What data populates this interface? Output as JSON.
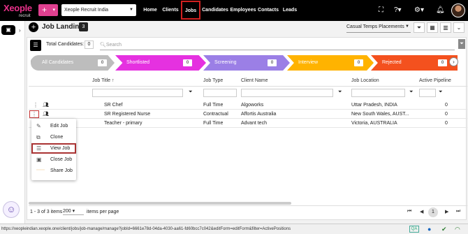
{
  "topbar": {
    "logo_brand": "Xeople",
    "logo_sub": "recruit",
    "add_label": "+",
    "tenant": "Xeople Recruit India",
    "nav": [
      "Home",
      "Clients",
      "Jobs",
      "Candidates",
      "Employees",
      "Contacts",
      "Leads"
    ],
    "active_nav": "Jobs"
  },
  "page": {
    "title": "Job Landing",
    "count": "3",
    "view_select": "Casual Temps Placements"
  },
  "grid": {
    "total_label": "Total Candidates:",
    "total_value": "0",
    "search_placeholder": "Search"
  },
  "stages": [
    {
      "label": "All Candidates",
      "count": "0",
      "color": "#bdbdbd"
    },
    {
      "label": "Shortlisted",
      "count": "0",
      "color": "#e531e0"
    },
    {
      "label": "Screening",
      "count": "0",
      "color": "#9b7fe6"
    },
    {
      "label": "Interview",
      "count": "0",
      "color": "#ffb300"
    },
    {
      "label": "Rejected",
      "count": "0",
      "color": "#f4511e"
    }
  ],
  "table": {
    "headers": [
      "Job Title",
      "Job Type",
      "Client Name",
      "Job Location",
      "Active Pipeline"
    ],
    "rows": [
      {
        "title": "SR Chef",
        "type": "Full Time",
        "client": "Algoworks",
        "location": "Uttar Pradesh, INDIA",
        "pipeline": "0"
      },
      {
        "title": "SR Registered Nurse",
        "type": "Contractual",
        "client": "Affortis Australia",
        "location": "New South Wales, AUST...",
        "pipeline": "0"
      },
      {
        "title": "Teacher - primary",
        "type": "Full Time",
        "client": "Advant tech",
        "location": "Victoria, AUSTRALIA",
        "pipeline": "0"
      }
    ]
  },
  "context_menu": {
    "items": [
      "Edit Job",
      "Clone",
      "View Job",
      "Close Job",
      "Share Job"
    ],
    "highlighted": "View Job"
  },
  "pager": {
    "range": "1 - 3 of 3 items",
    "page_size": "200",
    "per_page_label": "items per page",
    "current_page": "1"
  },
  "status": {
    "url": "https://xeopleindian.xeople.one/client/jobs/job-manage/manage?jobId=6661e78d-04da-4030-aa61-fd60bcc7c042&editForm=editForm&filter=ActivePositions",
    "qa_label": "QA"
  },
  "colors": {
    "accent": "#e04090",
    "highlight_border": "#c23030"
  }
}
